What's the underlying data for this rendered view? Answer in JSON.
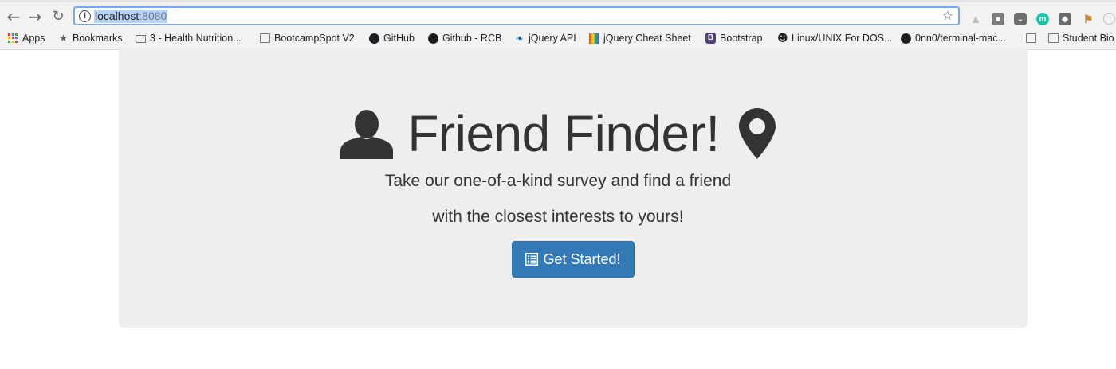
{
  "browser": {
    "url_host": "localhost",
    "url_port": ":8080",
    "bookmarks": [
      {
        "label": "Apps",
        "icon": "apps-grid-icon"
      },
      {
        "label": "Bookmarks",
        "icon": "star-icon"
      },
      {
        "label": "3 - Health Nutrition...",
        "icon": "folder-icon"
      },
      {
        "label": "BootcampSpot V2",
        "icon": "page-icon"
      },
      {
        "label": "GitHub",
        "icon": "github-icon"
      },
      {
        "label": "Github - RCB",
        "icon": "github-icon"
      },
      {
        "label": "jQuery API",
        "icon": "jquery-icon"
      },
      {
        "label": "jQuery Cheat Sheet",
        "icon": "rainbow-icon"
      },
      {
        "label": "Bootstrap",
        "icon": "bootstrap-icon"
      },
      {
        "label": "Linux/UNIX For DOS...",
        "icon": "tux-icon"
      },
      {
        "label": "0nn0/terminal-mac...",
        "icon": "github-icon"
      },
      {
        "label": "",
        "icon": "page-icon"
      },
      {
        "label": "Student Bio",
        "icon": "page-icon"
      }
    ],
    "extensions": [
      "drive-icon",
      "keep-icon",
      "pocket-icon",
      "m-icon",
      "evernote-icon",
      "flag-icon",
      "circle-icon"
    ],
    "ext_m_letter": "m",
    "bootstrap_letter": "B"
  },
  "hero": {
    "title": "Friend Finder!",
    "lead_line_1": "Take our one-of-a-kind survey and find a friend",
    "lead_line_2": "with the closest interests to yours!",
    "cta_label": "Get Started!"
  },
  "colors": {
    "jumbotron_bg": "#eeeeee",
    "text": "#333333",
    "button_primary": "#337ab7",
    "omnibox_focus": "#7aa7e6",
    "url_selection": "#b6d3f6"
  }
}
